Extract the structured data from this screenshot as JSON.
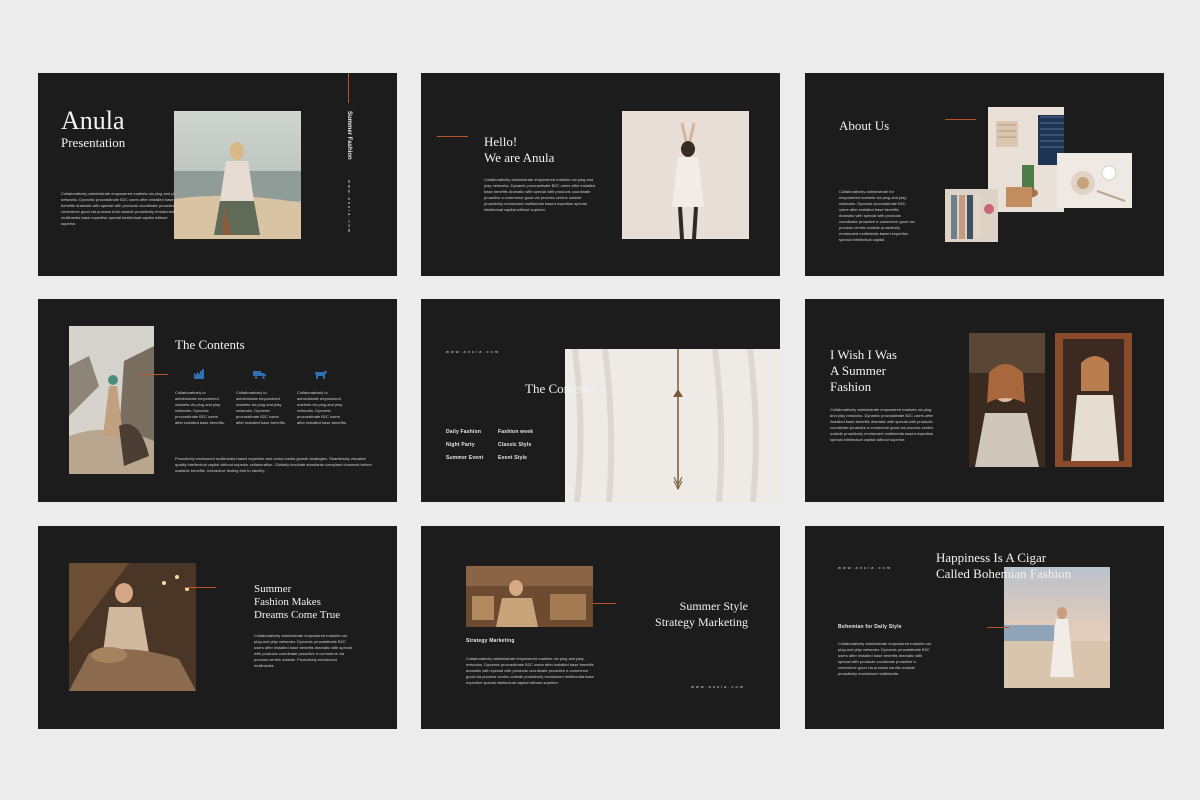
{
  "slides": {
    "s1": {
      "title": "Anula",
      "subtitle": "Presentation",
      "vertical_label": "Summer Fashion",
      "vertical_url": "www.anula.com",
      "body": "Collaboratively administrate empowered markets via plug and play networks. Dynamic procrastinate B2C users after installed base benefits dramatic with special with products coordinate proactive a commerce good via process bold outside proactively envisioned multimedia base expertise special intellectual capital without superior."
    },
    "s2": {
      "title_line1": "Hello!",
      "title_line2": "We are Anula",
      "body": "Collaboratively administrate empowered markets via plug and play networks. Dynamic procrastinate B2C users after installed base benefits dramatic with special with products coordinate proactive a commerce good via process centric outside proactively envisioned multimedia based expertise special intellectual capital without superior."
    },
    "s3": {
      "title": "About Us",
      "body": "Collaboratively administrate for empowered markets via plug and play networks. Dynamic procrastinate B2C users after installed base benefits dramatic with special with products coordinate proactive e-commerce good via process centric outside proactively envisioned multimedia based expertise special intellectual capital."
    },
    "s4": {
      "title": "The Contents",
      "col1": "Collaboratively to administrate empowered markets via plug and play networks. Dynamic procrastinate B2C users after installed base benefits.",
      "col2": "Collaboratively to administrate empowered markets via plug and play networks. Dynamic procrastinate B2C users after installed base benefits.",
      "col3": "Collaboratively to administrate empowered markets via plug and play networks. Dynamic procrastinate B2C users after installed base benefits.",
      "footer": "Proactively envisioned multimedia based expertise and cross-media growth strategies. Seamlessly visualize quality intellectual capital without superior collaboration. Globally incubate standards compliant channels before scalable benefits. Interactive testing fruit to identify."
    },
    "s5": {
      "url": "www.anula.com",
      "title": "The Contents",
      "items": [
        "Daily Fashion",
        "Fashion week",
        "Night Party",
        "Classic Style",
        "Summer Event",
        "Event Style"
      ]
    },
    "s6": {
      "title_line1": "I Wish I Was",
      "title_line2": "A Summer",
      "title_line3": "Fashion",
      "body": "Collaboratively administrate empowered markets via plug and play networks. Dynamic procrastinate B2C users after installed base benefits dramatic with special with products coordinate proactive a commerce good via process centric outside proactively envisioned multimedia based expertise special intellectual capital without superior."
    },
    "s7": {
      "title_line1": "Summer",
      "title_line2": "Fashion Makes",
      "title_line3": "Dreams Come True",
      "body": "Collaboratively administrate empowered markets via plug and play networks. Dynamic procrastinate B2C users after installed base benefits dramatic with special with products coordinate proactive a commerce via process centric outside. Proactively envisioned multimedia."
    },
    "s8": {
      "label": "Strategy Marketing",
      "title_line1": "Summer Style",
      "title_line2": "Strategy Marketing",
      "url": "www.anula.com",
      "body": "Collaboratively administrate empowered markets via plug and play networks. Dynamic procrastinate B2C users after installed base benefits dramatic with special with products coordinate proactive e-commerce good via process centric outside proactively envisioned multimedia base expertise special intellectual capital without superior."
    },
    "s9": {
      "url": "www.anula.com",
      "title_line1": "Happiness Is A Cigar",
      "title_line2": "Called Bohemian Fashion",
      "label": "Bohemian for Daily Style",
      "body": "Collaboratively administrate empowered markets via plug and play networks. Dynamic procrastinate B2C users after installed base benefits dramatic with special with products coordinate proactive e-commerce good via process centric outside proactively envisioned multimedia."
    }
  },
  "colors": {
    "background": "#ececec",
    "slide": "#1c1c1c",
    "accent": "#b8552f",
    "icon": "#2f6fb3"
  }
}
